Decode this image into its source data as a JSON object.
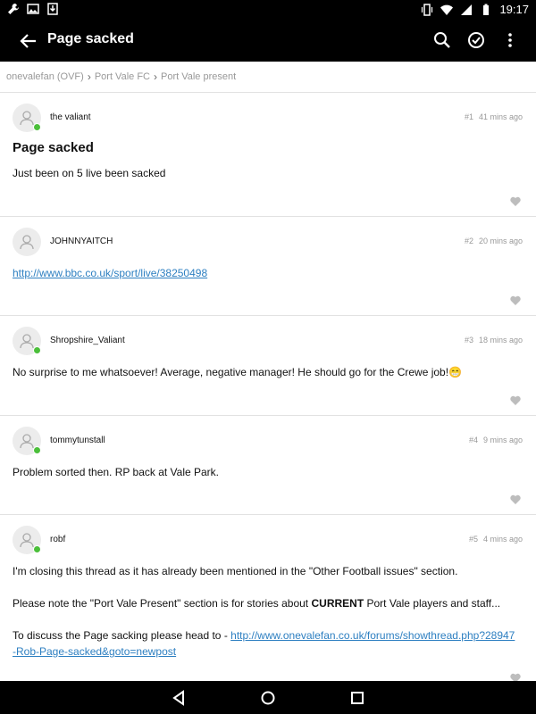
{
  "status": {
    "time": "19:17"
  },
  "appbar": {
    "title": "Page sacked"
  },
  "breadcrumb": [
    "onevalefan (OVF)",
    "Port Vale FC",
    "Port Vale present"
  ],
  "posts": [
    {
      "user": "the valiant",
      "num": "#1",
      "time": "41 mins ago",
      "title": "Page sacked",
      "text": "Just been on 5 live been sacked"
    },
    {
      "user": "JOHNNYAITCH",
      "num": "#2",
      "time": "20 mins ago",
      "link": "http://www.bbc.co.uk/sport/live/38250498"
    },
    {
      "user": "Shropshire_Valiant",
      "num": "#3",
      "time": "18 mins ago",
      "text": "No surprise to me whatsoever! Average, negative manager! He should go for the Crewe job!",
      "emoji": "😁"
    },
    {
      "user": "tommytunstall",
      "num": "#4",
      "time": "9 mins ago",
      "text": "Problem sorted then. RP back at Vale Park."
    },
    {
      "user": "robf",
      "num": "#5",
      "time": "4 mins ago",
      "line1": "I'm closing this thread as it has already been mentioned in the \"Other Football issues\" section.",
      "line2_a": "Please note the \"Port Vale Present\" section is for stories about ",
      "line2_b": "CURRENT",
      "line2_c": " Port Vale players and staff...",
      "line3_a": "To discuss the Page sacking please head to - ",
      "line3_link": "http://www.onevalefan.co.uk/forums/showthread.php?28947-Rob-Page-sacked&goto=newpost"
    }
  ]
}
